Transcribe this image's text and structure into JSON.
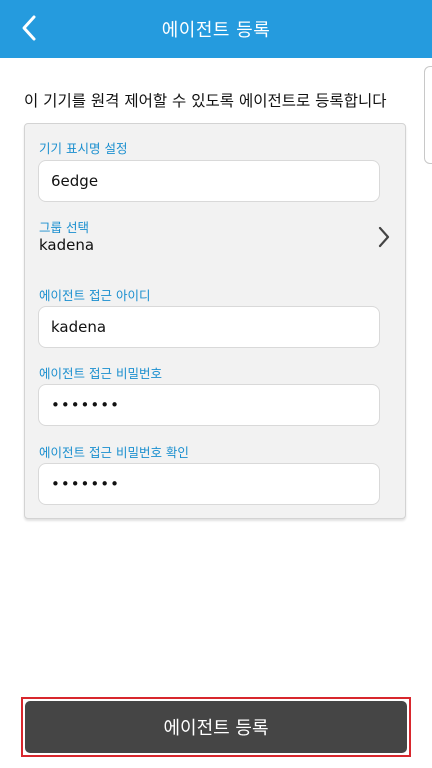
{
  "header": {
    "title": "에이전트 등록",
    "back_icon": "chevron-left-icon"
  },
  "intro_text": "이 기기를 원격 제어할 수 있도록 에이전트로 등록합니다",
  "form": {
    "device_name": {
      "label": "기기 표시명 설정",
      "value": "6edge"
    },
    "group": {
      "label": "그룹 선택",
      "value": "kadena",
      "icon": "chevron-right-icon"
    },
    "agent_id": {
      "label": "에이전트 접근 아이디",
      "value": "kadena"
    },
    "agent_password": {
      "label": "에이전트 접근 비밀번호",
      "value": "•••••••"
    },
    "agent_password_confirm": {
      "label": "에이전트 접근 비밀번호 확인",
      "value": "•••••••"
    }
  },
  "submit": {
    "label": "에이전트 등록"
  },
  "colors": {
    "header": "#259bde",
    "label": "#1a8fcf",
    "submit_bg": "#454545",
    "highlight": "#d8272d"
  }
}
